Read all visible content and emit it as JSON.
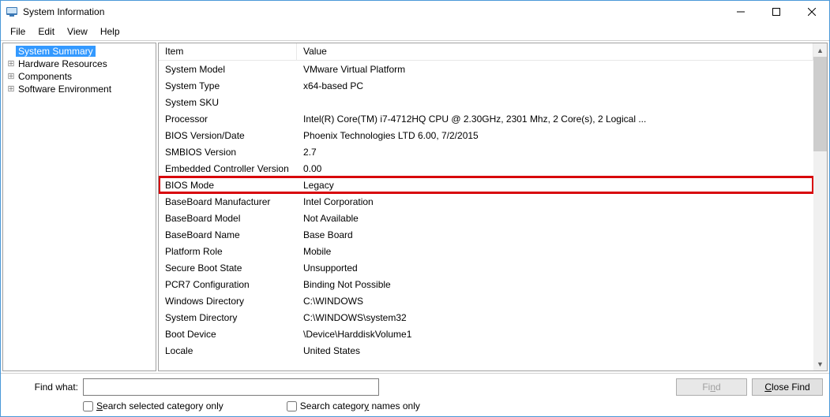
{
  "window": {
    "title": "System Information",
    "minimize": "—",
    "maximize": "□",
    "close": "✕"
  },
  "menu": {
    "file": "File",
    "edit": "Edit",
    "view": "View",
    "help": "Help"
  },
  "tree": {
    "summary": "System Summary",
    "hardware": "Hardware Resources",
    "components": "Components",
    "software": "Software Environment"
  },
  "columns": {
    "item": "Item",
    "value": "Value"
  },
  "rows": [
    {
      "item": "System Model",
      "value": "VMware Virtual Platform",
      "hl": false
    },
    {
      "item": "System Type",
      "value": "x64-based PC",
      "hl": false
    },
    {
      "item": "System SKU",
      "value": "",
      "hl": false
    },
    {
      "item": "Processor",
      "value": "Intel(R) Core(TM) i7-4712HQ CPU @ 2.30GHz, 2301 Mhz, 2 Core(s), 2 Logical ...",
      "hl": false
    },
    {
      "item": "BIOS Version/Date",
      "value": "Phoenix Technologies LTD 6.00, 7/2/2015",
      "hl": false
    },
    {
      "item": "SMBIOS Version",
      "value": "2.7",
      "hl": false
    },
    {
      "item": "Embedded Controller Version",
      "value": "0.00",
      "hl": false
    },
    {
      "item": "BIOS Mode",
      "value": "Legacy",
      "hl": true
    },
    {
      "item": "BaseBoard Manufacturer",
      "value": "Intel Corporation",
      "hl": false
    },
    {
      "item": "BaseBoard Model",
      "value": "Not Available",
      "hl": false
    },
    {
      "item": "BaseBoard Name",
      "value": "Base Board",
      "hl": false
    },
    {
      "item": "Platform Role",
      "value": "Mobile",
      "hl": false
    },
    {
      "item": "Secure Boot State",
      "value": "Unsupported",
      "hl": false
    },
    {
      "item": "PCR7 Configuration",
      "value": "Binding Not Possible",
      "hl": false
    },
    {
      "item": "Windows Directory",
      "value": "C:\\WINDOWS",
      "hl": false
    },
    {
      "item": "System Directory",
      "value": "C:\\WINDOWS\\system32",
      "hl": false
    },
    {
      "item": "Boot Device",
      "value": "\\Device\\HarddiskVolume1",
      "hl": false
    },
    {
      "item": "Locale",
      "value": "United States",
      "hl": false
    }
  ],
  "find": {
    "label": "Find what:",
    "placeholder": "",
    "find_btn_pre": "Fi",
    "find_btn_ul": "n",
    "find_btn_post": "d",
    "close_btn_pre": "",
    "close_btn_ul": "C",
    "close_btn_post": "lose Find",
    "cb1_ul": "S",
    "cb1_post": "earch selected category only",
    "cb2_pre": "Search categor",
    "cb2_ul": "y",
    "cb2_post": " names only"
  }
}
